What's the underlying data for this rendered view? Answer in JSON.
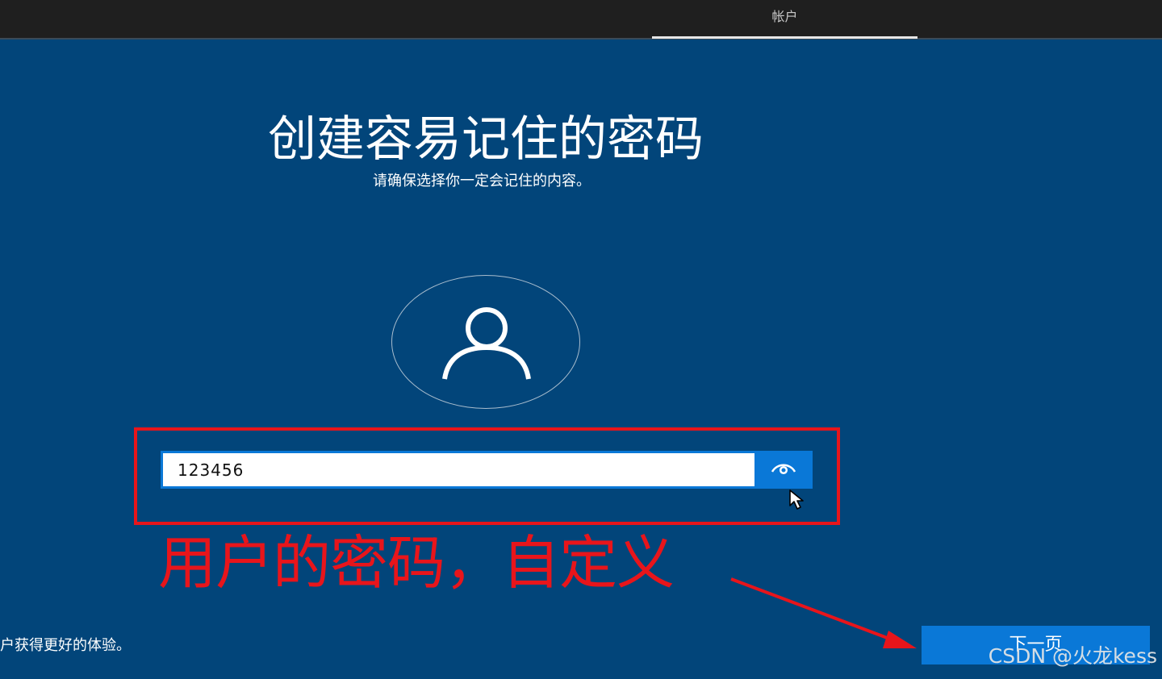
{
  "header": {
    "tab_label": "帐户"
  },
  "main": {
    "title": "创建容易记住的密码",
    "subtitle": "请确保选择你一定会记住的内容。",
    "password_value": "123456",
    "privacy_text": "户获得更好的体验。",
    "next_label": "下一页"
  },
  "annotation": {
    "text": "用户的密码，自定义",
    "color": "#e8151b"
  },
  "watermark": "CSDN @火龙kess",
  "icons": {
    "avatar": "user-icon",
    "reveal": "eye-icon",
    "cursor": "mouse-pointer-icon"
  },
  "colors": {
    "background": "#02457a",
    "topbar": "#1f1f1f",
    "accent": "#0a78d7",
    "annotation": "#e8151b"
  }
}
